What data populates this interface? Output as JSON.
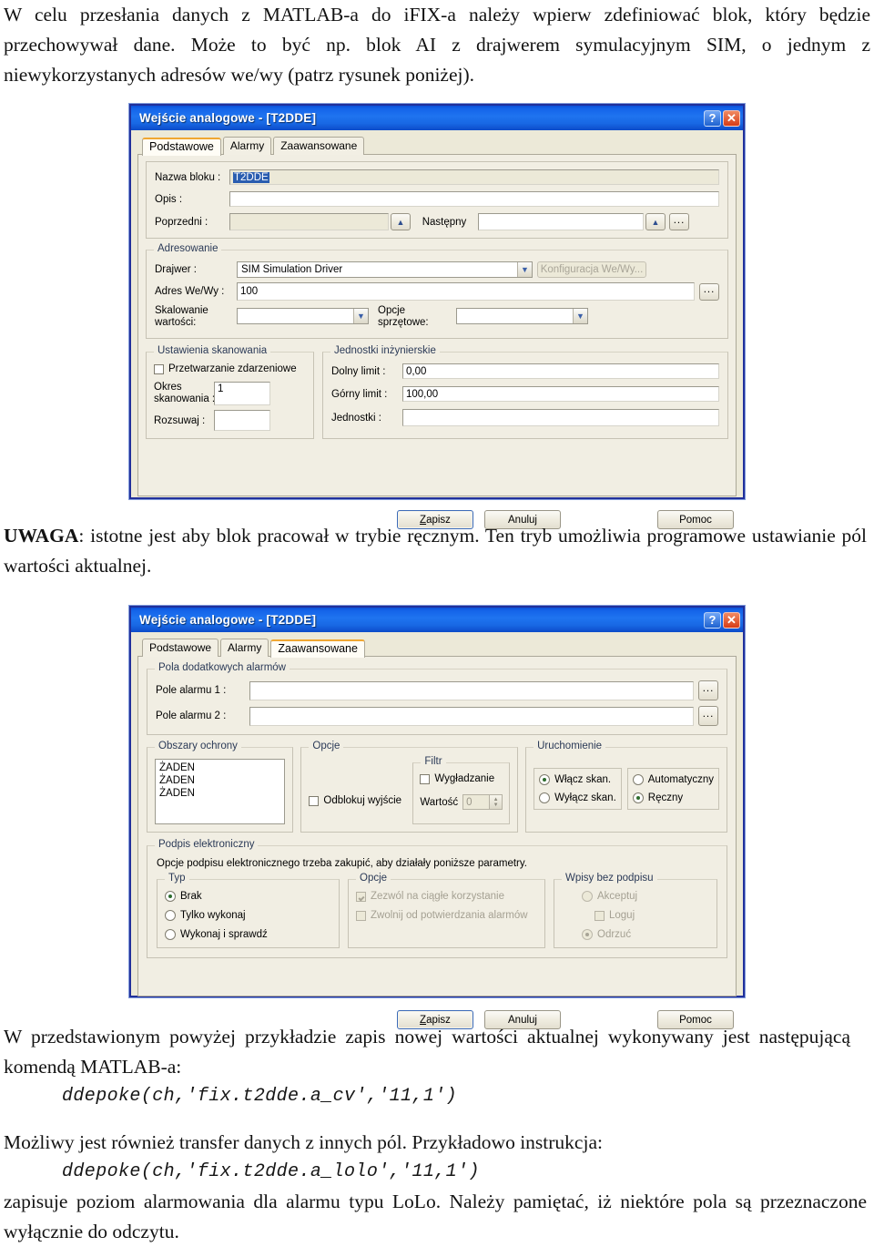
{
  "document": {
    "paragraph_top": "W celu przesłania danych z MATLAB-a do iFIX-a należy wpierw zdefiniować blok, który będzie przechowywał dane. Może to być np. blok AI z drajwerem symulacyjnym SIM, o jednym z niewykorzystanych adresów we/wy (patrz rysunek poniżej).",
    "note_label": "UWAGA",
    "paragraph_note": ": istotne jest aby blok pracował w trybie ręcznym. Ten tryb umożliwia programowe ustawianie pól wartości aktualnej.",
    "paragraph_bottom_1": "W przedstawionym powyżej przykładzie zapis nowej wartości aktualnej wykonywany jest następującą komendą MATLAB-a:",
    "code_1": "ddepoke(ch,'fix.t2dde.a_cv','11,1')",
    "paragraph_bottom_2": "Możliwy jest również transfer danych z innych pól. Przykładowo instrukcja:",
    "code_2": "ddepoke(ch,'fix.t2dde.a_lolo','11,1')",
    "paragraph_bottom_3": "zapisuje poziom alarmowania dla alarmu typu LoLo. Należy pamiętać, iż niektóre pola są przeznaczone wyłącznie do odczytu."
  },
  "colors": {
    "titlebar_blue": "#1f74f0",
    "dialog_border": "#21309b",
    "dialog_face": "#ece9d8",
    "tab_active_accent": "#f0a732",
    "selection_blue": "#2a5db0",
    "close_red": "#d63c16"
  },
  "dialog1": {
    "title": "Wejście analogowe - [T2DDE]",
    "titlebar_buttons": {
      "help": "?",
      "close": "✕"
    },
    "tabs": [
      {
        "label": "Podstawowe",
        "active": true
      },
      {
        "label": "Alarmy",
        "active": false
      },
      {
        "label": "Zaawansowane",
        "active": false
      }
    ],
    "identity": {
      "block_name_label": "Nazwa bloku :",
      "block_name_value": "T2DDE",
      "description_label": "Opis :",
      "description_value": "",
      "previous_label": "Poprzedni :",
      "previous_value": "",
      "next_label": "Następny",
      "next_value": "",
      "browse_button": "...",
      "up_arrow": "▲"
    },
    "addressing": {
      "group_label": "Adresowanie",
      "driver_label": "Drajwer :",
      "driver_value": "SIM    Simulation Driver",
      "io_config_button": "Konfiguracja We/Wy...",
      "io_address_label": "Adres We/Wy :",
      "io_address_value": "100",
      "browse_button": "...",
      "scaling_label_line1": "Skalowanie",
      "scaling_label_line2": "wartości:",
      "scaling_value": "",
      "hardware_label_line1": "Opcje",
      "hardware_label_line2": "sprzętowe:",
      "hardware_value": ""
    },
    "scan_settings": {
      "group_label": "Ustawienia skanowania",
      "event_processing_label": "Przetwarzanie zdarzeniowe",
      "event_processing_checked": false,
      "scan_period_label_line1": "Okres",
      "scan_period_label_line2": "skanowania :",
      "scan_period_value": "1",
      "phase_label": "Rozsuwaj :",
      "phase_value": ""
    },
    "engineering_units": {
      "group_label": "Jednostki inżynierskie",
      "low_limit_label": "Dolny limit :",
      "low_limit_value": "0,00",
      "high_limit_label": "Górny limit :",
      "high_limit_value": "100,00",
      "units_label": "Jednostki :",
      "units_value": ""
    },
    "footer": {
      "save": "Zapisz",
      "save_mnemonic": "Z",
      "cancel": "Anuluj",
      "help": "Pomoc"
    }
  },
  "dialog2": {
    "title": "Wejście analogowe - [T2DDE]",
    "titlebar_buttons": {
      "help": "?",
      "close": "✕"
    },
    "tabs": [
      {
        "label": "Podstawowe",
        "active": false
      },
      {
        "label": "Alarmy",
        "active": false
      },
      {
        "label": "Zaawansowane",
        "active": true
      }
    ],
    "extra_alarm_fields": {
      "group_label": "Pola dodatkowych alarmów",
      "field1_label": "Pole alarmu 1 :",
      "field1_value": "",
      "field2_label": "Pole alarmu 2 :",
      "field2_value": "",
      "browse_button": "..."
    },
    "security_areas": {
      "group_label": "Obszary ochrony",
      "items": [
        "ŻADEN",
        "ŻADEN",
        "ŻADEN"
      ]
    },
    "options": {
      "group_label": "Opcje",
      "unlock_output_label": "Odblokuj wyjście",
      "unlock_output_checked": false,
      "filter": {
        "group_label": "Filtr",
        "smoothing_label": "Wygładzanie",
        "smoothing_checked": false,
        "value_label": "Wartość",
        "value": "0"
      }
    },
    "startup": {
      "group_label": "Uruchomienie",
      "scan_on_label": "Włącz skan.",
      "scan_on_selected": true,
      "scan_off_label": "Wyłącz skan.",
      "scan_off_selected": false,
      "automatic_label": "Automatyczny",
      "automatic_selected": false,
      "manual_label": "Ręczny",
      "manual_selected": true
    },
    "esignature": {
      "group_label": "Podpis elektroniczny",
      "notice": "Opcje podpisu elektronicznego trzeba zakupić, aby działały poniższe parametry.",
      "type": {
        "group_label": "Typ",
        "options": [
          {
            "label": "Brak",
            "selected": true
          },
          {
            "label": "Tylko wykonaj",
            "selected": false
          },
          {
            "label": "Wykonaj i sprawdź",
            "selected": false
          }
        ]
      },
      "opts": {
        "group_label": "Opcje",
        "items": [
          {
            "label": "Zezwól na ciągłe korzystanie",
            "checked": true,
            "disabled": true
          },
          {
            "label": "Zwolnij od potwierdzania alarmów",
            "checked": false,
            "disabled": true
          }
        ]
      },
      "unsigned": {
        "group_label": "Wpisy bez podpisu",
        "accept_label": "Akceptuj",
        "accept_selected": false,
        "log_label": "Loguj",
        "log_checked": false,
        "reject_label": "Odrzuć",
        "reject_selected": true
      }
    },
    "footer": {
      "save": "Zapisz",
      "save_mnemonic": "Z",
      "cancel": "Anuluj",
      "help": "Pomoc"
    }
  }
}
